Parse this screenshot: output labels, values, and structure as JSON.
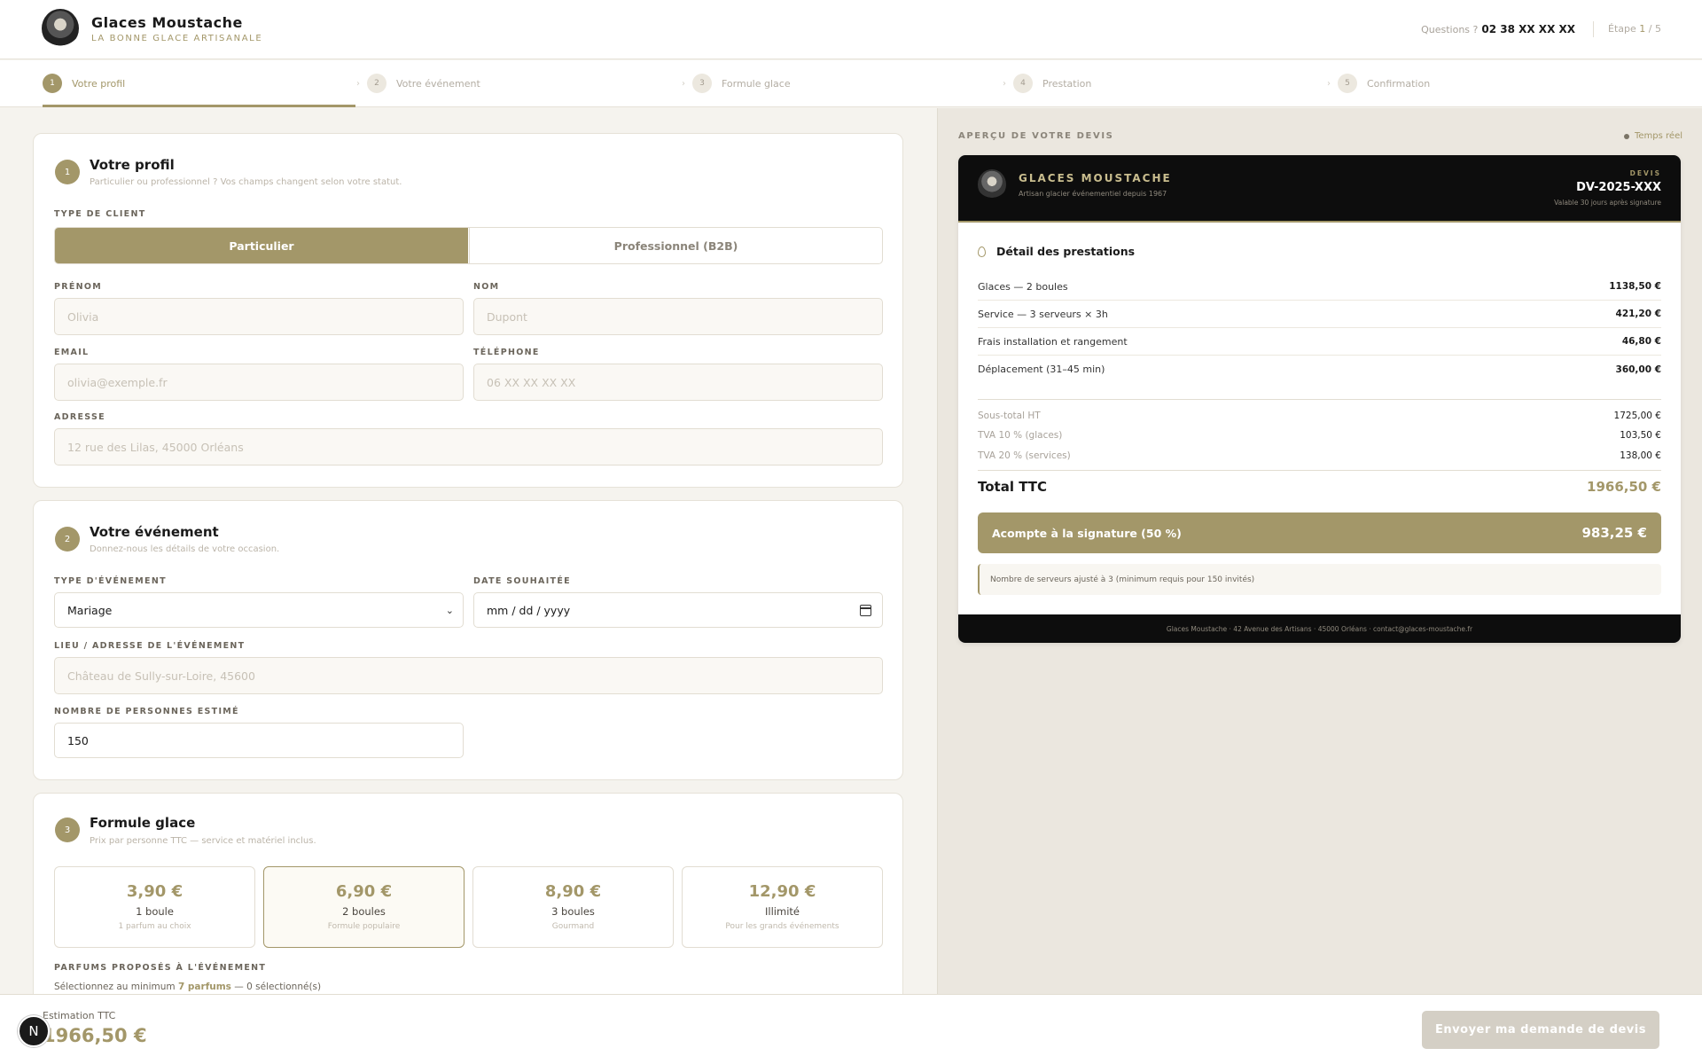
{
  "header": {
    "brand": "Glaces Moustache",
    "tagline": "LA BONNE GLACE ARTISANALE",
    "questions_label": "Questions ?",
    "phone": "02 38 XX XX XX",
    "step_label": "Étape",
    "step_current": "1",
    "step_total": "/ 5"
  },
  "stepper": [
    {
      "num": "1",
      "label": "Votre profil"
    },
    {
      "num": "2",
      "label": "Votre événement"
    },
    {
      "num": "3",
      "label": "Formule glace"
    },
    {
      "num": "4",
      "label": "Prestation"
    },
    {
      "num": "5",
      "label": "Confirmation"
    }
  ],
  "profile": {
    "num": "1",
    "title": "Votre profil",
    "subtitle": "Particulier ou professionnel ? Vos champs changent selon votre statut.",
    "client_type_label": "TYPE DE CLIENT",
    "option_private": "Particulier",
    "option_b2b": "Professionnel (B2B)",
    "firstname_label": "PRÉNOM",
    "firstname_placeholder": "Olivia",
    "lastname_label": "NOM",
    "lastname_placeholder": "Dupont",
    "email_label": "EMAIL",
    "email_placeholder": "olivia@exemple.fr",
    "phone_label": "TÉLÉPHONE",
    "phone_placeholder": "06 XX XX XX XX",
    "address_label": "ADRESSE",
    "address_placeholder": "12 rue des Lilas, 45000 Orléans"
  },
  "event": {
    "num": "2",
    "title": "Votre événement",
    "subtitle": "Donnez-nous les détails de votre occasion.",
    "type_label": "TYPE D'ÉVÉNEMENT",
    "type_value": "Mariage",
    "date_label": "DATE SOUHAITÉE",
    "date_value": "mm / dd / yyyy",
    "place_label": "LIEU / ADRESSE DE L'ÉVÉNEMENT",
    "place_placeholder": "Château de Sully-sur-Loire, 45600",
    "guests_label": "NOMBRE DE PERSONNES ESTIMÉ",
    "guests_value": "150"
  },
  "formula": {
    "num": "3",
    "title": "Formule glace",
    "subtitle": "Prix par personne TTC — service et matériel inclus.",
    "options": [
      {
        "price": "3,90 €",
        "name": "1 boule",
        "desc": "1 parfum au choix"
      },
      {
        "price": "6,90 €",
        "name": "2 boules",
        "desc": "Formule populaire"
      },
      {
        "price": "8,90 €",
        "name": "3 boules",
        "desc": "Gourmand"
      },
      {
        "price": "12,90 €",
        "name": "Illimité",
        "desc": "Pour les grands événements"
      }
    ],
    "flavors_label": "PARFUMS PROPOSÉS À L'ÉVÉNEMENT",
    "flavors_text_pre": "Sélectionnez au minimum",
    "flavors_min": "7 parfums",
    "flavors_text_post": "— 0 sélectionné(s)"
  },
  "quote": {
    "panel_label": "APERÇU DE VOTRE DEVIS",
    "live_label": "Temps réel",
    "brand": "GLACES MOUSTACHE",
    "brand_sub": "Artisan glacier événementiel depuis 1967",
    "devis_label": "DEVIS",
    "devis_number": "DV-2025-XXX",
    "validity": "Valable 30 jours après signature",
    "section_title": "Détail des prestations",
    "lines": [
      {
        "label": "Glaces — 2 boules",
        "amount": "1138,50 €"
      },
      {
        "label": "Service — 3 serveurs × 3h",
        "amount": "421,20 €"
      },
      {
        "label": "Frais installation et rangement",
        "amount": "46,80 €"
      },
      {
        "label": "Déplacement (31–45 min)",
        "amount": "360,00 €"
      }
    ],
    "subtotals": [
      {
        "label": "Sous-total HT",
        "amount": "1725,00 €"
      },
      {
        "label": "TVA 10 % (glaces)",
        "amount": "103,50 €"
      },
      {
        "label": "TVA 20 % (services)",
        "amount": "138,00 €"
      }
    ],
    "total_label": "Total TTC",
    "total_value": "1966,50 €",
    "deposit_label": "Acompte à la signature (50 %)",
    "deposit_value": "983,25 €",
    "note": "Nombre de serveurs ajusté à 3 (minimum requis pour 150 invités)",
    "footer": "Glaces Moustache · 42 Avenue des Artisans · 45000 Orléans · contact@glaces-moustache.fr"
  },
  "bottom": {
    "estimate_label": "Estimation TTC",
    "estimate_value": "1966,50 €",
    "badge": "N",
    "send_label": "Envoyer ma demande de devis"
  },
  "colors": {
    "accent": "#a39769",
    "dark": "#0d0d0d",
    "panel_bg": "#ebe7df"
  }
}
